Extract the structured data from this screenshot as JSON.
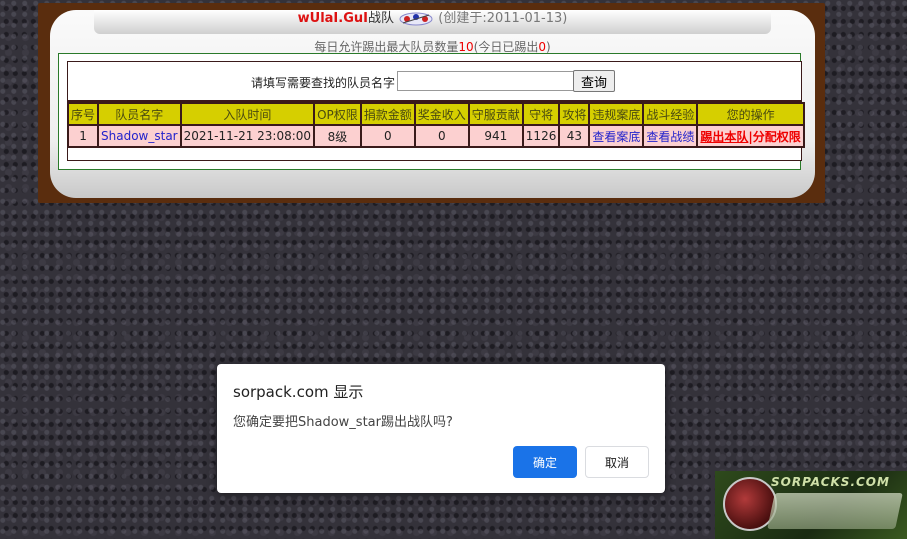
{
  "header": {
    "team_name": "wUlaI.GuI",
    "team_suffix": "战队",
    "created": "(创建于:2011-01-13)"
  },
  "quota": {
    "prefix": "每日允许踢出最大队员数量",
    "max": "10",
    "middle": "(今日已踢出",
    "kicked": "0",
    "suffix": ")"
  },
  "search": {
    "label": "请填写需要查找的队员名字",
    "value": "",
    "button": "查询"
  },
  "table": {
    "headers": [
      "序号",
      "队员名字",
      "入队时间",
      "OP权限",
      "捐款金额",
      "奖金收入",
      "守服贡献",
      "守将",
      "攻将",
      "违规案底",
      "战斗经验",
      "您的操作"
    ],
    "rows": [
      {
        "index": "1",
        "name": "Shadow_star",
        "joined": "2021-11-21 23:08:00",
        "op": "8级",
        "donation": "0",
        "bonus": "0",
        "defense_contrib": "941",
        "defenders": "1126",
        "attackers": "43",
        "violations": "查看案底",
        "battle_exp": "查看战绩",
        "action_kick": "踢出本队",
        "action_sep": "|",
        "action_assign": "分配权限"
      }
    ]
  },
  "dialog": {
    "title": "sorpack.com 显示",
    "message": "您确定要把Shadow_star踢出战队吗?",
    "ok": "确定",
    "cancel": "取消"
  },
  "watermark": {
    "text": "SORPACKS.COM"
  },
  "colors": {
    "frame": "#5a2d0e",
    "header_cell": "#d6cf00",
    "data_cell": "#fcd0d0",
    "dialog_ok": "#1a73e8",
    "team_name": "#dd1111"
  }
}
